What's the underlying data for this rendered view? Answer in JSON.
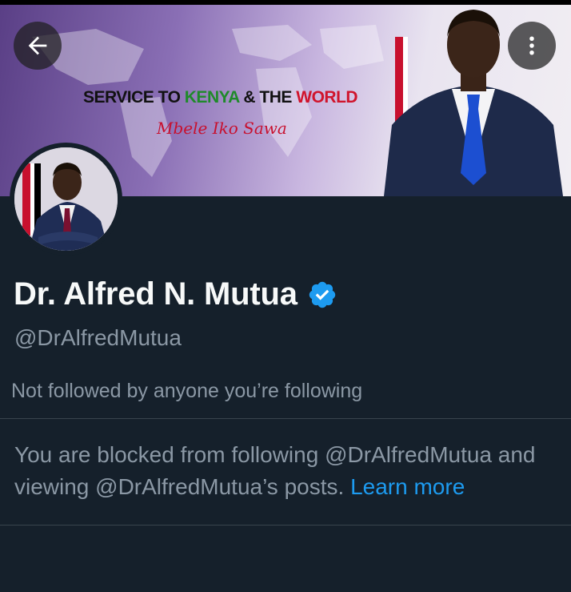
{
  "header": {
    "back_icon": "arrow-left-icon",
    "more_icon": "more-vertical-icon"
  },
  "banner": {
    "slogan": {
      "part1": "SERVICE TO ",
      "part2": "KENYA",
      "part3": " & THE ",
      "part4": "WORLD"
    },
    "tagline": "Mbele Iko Sawa",
    "colors": {
      "kenya_green": "#1f8a2a",
      "world_red": "#d0142c",
      "tagline_red": "#c8102e"
    }
  },
  "profile": {
    "name": "Dr. Alfred N. Mutua",
    "verified_icon": "verified-badge-icon",
    "handle": "@DrAlfredMutua",
    "followers_note": "Not followed by anyone you’re following"
  },
  "blocked_notice": {
    "text": "You are blocked from following @DrAlfredMutua and viewing @DrAlfredMutua’s posts.",
    "link": "Learn more"
  },
  "theme": {
    "background": "#15202b",
    "secondary_text": "#8b98a5",
    "link": "#1d9bf0",
    "divider": "#38444d"
  }
}
